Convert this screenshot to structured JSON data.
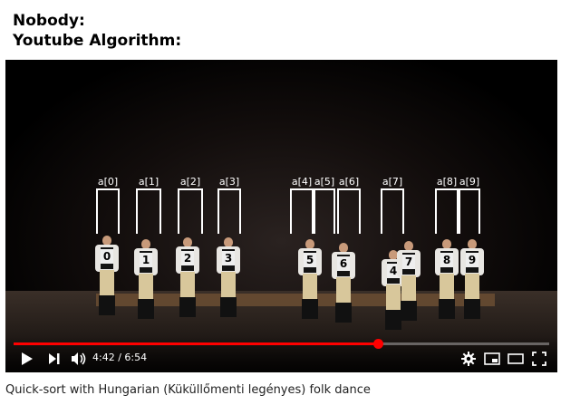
{
  "meme": {
    "line1": "Nobody:",
    "line2": "Youtube Algorithm:"
  },
  "video": {
    "array_labels": [
      "a[0]",
      "a[1]",
      "a[2]",
      "a[3]",
      "a[4]",
      "a[5]",
      "a[6]",
      "a[7]",
      "a[8]",
      "a[9]"
    ],
    "dancer_numbers": [
      "0",
      "1",
      "2",
      "3",
      "5",
      "6",
      "4",
      "7",
      "8",
      "9"
    ],
    "current_time": "4:42",
    "duration": "6:54",
    "time_display": "4:42 / 6:54",
    "progress_fraction": 0.68,
    "accent_color": "#ff0000",
    "icons": [
      "play-icon",
      "next-icon",
      "volume-icon",
      "settings-icon",
      "miniplayer-icon",
      "theater-icon",
      "fullscreen-icon"
    ]
  },
  "caption": "Quick-sort with Hungarian (Küküllőmenti legényes) folk dance"
}
